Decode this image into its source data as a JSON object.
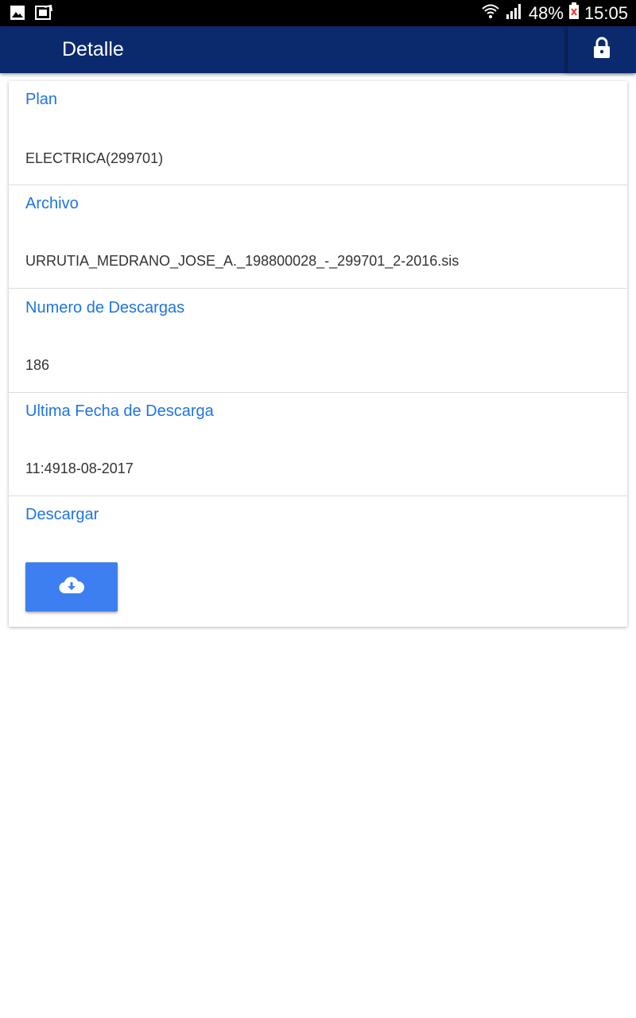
{
  "status_bar": {
    "battery": "48%",
    "time": "15:05",
    "icons": [
      "gallery-icon",
      "screenshot-icon",
      "wifi-icon",
      "signal-icon",
      "battery-icon"
    ]
  },
  "app_bar": {
    "title": "Detalle",
    "action_icon": "lock-icon"
  },
  "details": {
    "plan": {
      "label": "Plan",
      "value": "ELECTRICA(299701)"
    },
    "archivo": {
      "label": "Archivo",
      "value": "URRUTIA_MEDRANO_JOSE_A._198800028_-_299701_2-2016.sis"
    },
    "descargas": {
      "label": "Numero de Descargas",
      "value": "186"
    },
    "fecha": {
      "label": "Ultima Fecha de Descarga",
      "value": "11:4918-08-2017"
    },
    "descargar": {
      "label": "Descargar",
      "button_icon": "cloud-download-icon"
    }
  },
  "colors": {
    "app_bar": "#0b2a6e",
    "label": "#1e74e6",
    "button": "#3d7ff0"
  }
}
